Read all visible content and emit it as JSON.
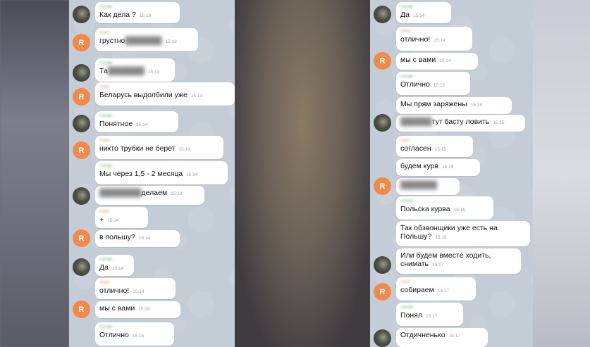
{
  "left_panel": {
    "messages": [
      {
        "sender": "Гоглак",
        "sender_color": "green",
        "avatar": "photo",
        "text": "Как дела ?",
        "time": "15:13"
      },
      {
        "sender": "Rutin",
        "sender_color": "orange",
        "avatar": "R",
        "text": "грустно",
        "blurred": "███████",
        "time": "15:13"
      },
      {
        "sender": "Гоглак",
        "sender_color": "green",
        "avatar": "photo",
        "text": "Та",
        "blurred": "███████",
        "time": "15:13"
      },
      {
        "sender": "Rutin",
        "sender_color": "orange",
        "avatar": "R",
        "text": "Беларусь выдолбили уже",
        "time": "15:13"
      },
      {
        "sender": "Гоглак",
        "sender_color": "green",
        "avatar": "photo",
        "text": "Понятное",
        "time": "15:14"
      },
      {
        "sender": "Rutin",
        "sender_color": "orange",
        "avatar": "R",
        "text": "никто трубки не берет",
        "time": "15:14"
      },
      {
        "sender": "Гоглак",
        "sender_color": "green",
        "avatar": "none",
        "text": "Мы через 1,5 - 2 месяца",
        "time": "15:14"
      },
      {
        "sender": "",
        "sender_color": "green",
        "avatar": "photo",
        "text": "делаем",
        "blurred": "████████",
        "time": "15:14"
      },
      {
        "sender": "Rutin",
        "sender_color": "orange",
        "avatar": "none",
        "text": "+",
        "time": "15:14"
      },
      {
        "sender": "",
        "sender_color": "orange",
        "avatar": "R",
        "text": "в польшу?",
        "time": "15:14"
      },
      {
        "sender": "Гоглак",
        "sender_color": "green",
        "avatar": "photo",
        "text": "Да",
        "time": "15:14"
      },
      {
        "sender": "Rutin",
        "sender_color": "orange",
        "avatar": "none",
        "text": "отлично!",
        "time": "15:14"
      },
      {
        "sender": "",
        "sender_color": "orange",
        "avatar": "R",
        "text": "мы с вами",
        "time": "15:14"
      },
      {
        "sender": "Гоглак",
        "sender_color": "green",
        "avatar": "none",
        "text": "Отлично",
        "time": "15:15"
      }
    ]
  },
  "right_panel": {
    "messages": [
      {
        "sender": "Гоглак",
        "sender_color": "green",
        "avatar": "photo",
        "text": "Да",
        "time": "15:14"
      },
      {
        "sender": "Rutin",
        "sender_color": "orange",
        "avatar": "none",
        "text": "отлично!",
        "time": "15:14"
      },
      {
        "sender": "",
        "sender_color": "orange",
        "avatar": "R",
        "text": "мы с вами",
        "time": "15:14"
      },
      {
        "sender": "Гоглак",
        "sender_color": "green",
        "avatar": "none",
        "text": "Отлично",
        "time": "15:15"
      },
      {
        "sender": "",
        "sender_color": "green",
        "avatar": "none",
        "text": "Мы прям заряжены",
        "time": "15:15"
      },
      {
        "sender": "",
        "sender_color": "green",
        "avatar": "photo",
        "text": "тут басту ловить",
        "blurred": "██████",
        "time": "15:15"
      },
      {
        "sender": "Rutin",
        "sender_color": "orange",
        "avatar": "none",
        "text": "согласен",
        "time": "15:15"
      },
      {
        "sender": "",
        "sender_color": "orange",
        "avatar": "none",
        "text": "будем курв",
        "time": "15:15"
      },
      {
        "sender": "",
        "sender_color": "orange",
        "avatar": "R",
        "text": "",
        "blurred": "███████",
        "time": ""
      },
      {
        "sender": "Гоглак",
        "sender_color": "green",
        "avatar": "none",
        "text": "Польска курва",
        "time": "15:16"
      },
      {
        "sender": "",
        "sender_color": "green",
        "avatar": "none",
        "text": "Так обзвонщики уже есть на\nПольшу?",
        "time": "15:16"
      },
      {
        "sender": "",
        "sender_color": "green",
        "avatar": "photo",
        "text": "Или будем вместе ходить,\nснимать",
        "time": "15:17"
      },
      {
        "sender": "Rutin",
        "sender_color": "orange",
        "avatar": "R",
        "text": "собираем",
        "time": "15:17"
      },
      {
        "sender": "Гоглак",
        "sender_color": "green",
        "avatar": "none",
        "text": "Понял",
        "time": "15:17"
      },
      {
        "sender": "",
        "sender_color": "green",
        "avatar": "photo",
        "text": "Отдичненько",
        "time": "15:17"
      }
    ]
  }
}
